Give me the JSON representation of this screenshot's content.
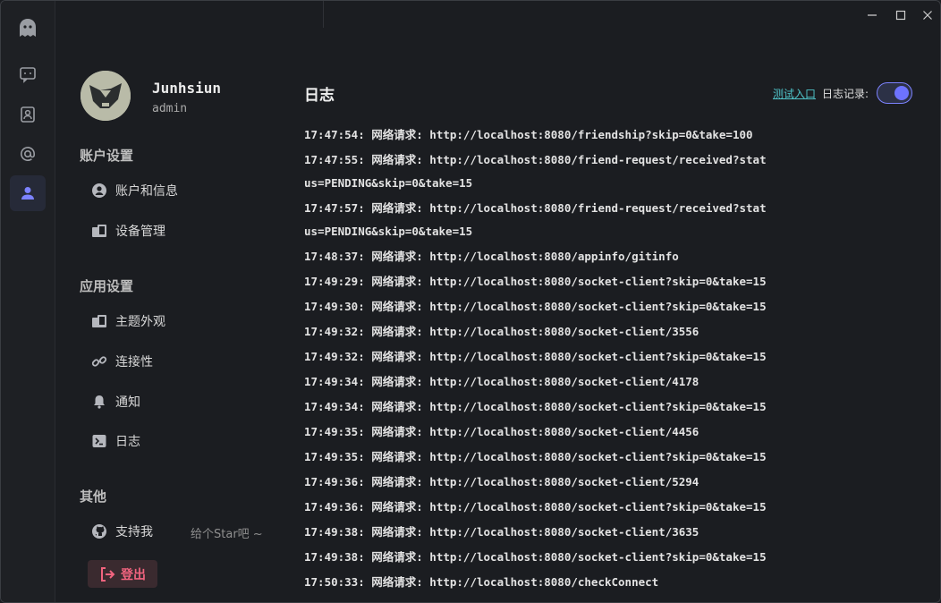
{
  "user": {
    "name": "Junhsiun",
    "role": "admin"
  },
  "sections": {
    "account": "账户设置",
    "app": "应用设置",
    "other": "其他"
  },
  "menu": {
    "account_info": "账户和信息",
    "device_manage": "设备管理",
    "theme": "主题外观",
    "connectivity": "连接性",
    "notification": "通知",
    "log": "日志",
    "support": "支持我",
    "support_hint": "给个Star吧 ~"
  },
  "logout_label": "登出",
  "main": {
    "title": "日志",
    "test_link": "测试入口",
    "log_record_label": "日志记录:",
    "log_record_enabled": true
  },
  "logs": [
    "17:47:54: 网络请求: http://localhost:8080/friendship?skip=0&take=100",
    "17:47:55: 网络请求: http://localhost:8080/friend-request/received?status=PENDING&skip=0&take=15",
    "17:47:57: 网络请求: http://localhost:8080/friend-request/received?status=PENDING&skip=0&take=15",
    "17:48:37: 网络请求: http://localhost:8080/appinfo/gitinfo",
    "17:49:29: 网络请求: http://localhost:8080/socket-client?skip=0&take=15",
    "17:49:30: 网络请求: http://localhost:8080/socket-client?skip=0&take=15",
    "17:49:32: 网络请求: http://localhost:8080/socket-client/3556",
    "17:49:32: 网络请求: http://localhost:8080/socket-client?skip=0&take=15",
    "17:49:34: 网络请求: http://localhost:8080/socket-client/4178",
    "17:49:34: 网络请求: http://localhost:8080/socket-client?skip=0&take=15",
    "17:49:35: 网络请求: http://localhost:8080/socket-client/4456",
    "17:49:35: 网络请求: http://localhost:8080/socket-client?skip=0&take=15",
    "17:49:36: 网络请求: http://localhost:8080/socket-client/5294",
    "17:49:36: 网络请求: http://localhost:8080/socket-client?skip=0&take=15",
    "17:49:38: 网络请求: http://localhost:8080/socket-client/3635",
    "17:49:38: 网络请求: http://localhost:8080/socket-client?skip=0&take=15",
    "17:50:33: 网络请求: http://localhost:8080/checkConnect"
  ],
  "colors": {
    "accent": "#6d73ff",
    "link": "#4fc3c8",
    "danger": "#f2647f"
  },
  "icons": {
    "logo": "ghost-icon",
    "chat": "chat-icon",
    "contacts": "contacts-icon",
    "mention": "at-icon",
    "profile": "user-icon"
  }
}
